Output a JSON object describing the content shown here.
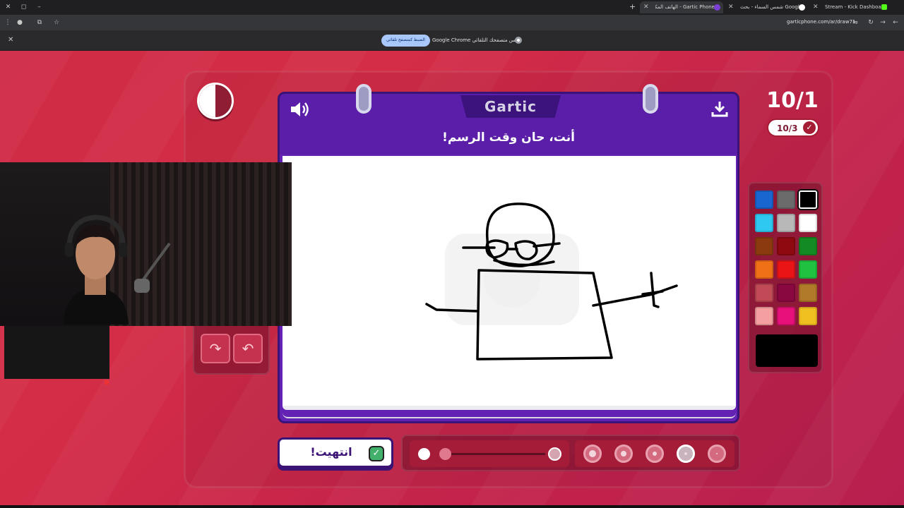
{
  "browser": {
    "tabs": [
      {
        "title": "Stream - Kick Dashboard",
        "active": false,
        "favicon_color": "#53fc18"
      },
      {
        "title": "شمس السماء - بحث Google",
        "active": false,
        "favicon_color": "#4285f4"
      },
      {
        "title": "Gartic Phone - الهاتف المكسور",
        "active": true,
        "favicon_color": "#7b3fd6"
      }
    ],
    "url": "garticphone.com/ar/draw71",
    "infobar_message": "Google Chrome ليس متصفحك التلقائي.",
    "infobar_button": "الضبط كمتصفح تلقائي"
  },
  "game": {
    "logo": "Gartic",
    "prompt": "أنت، حان وقت الرسم!",
    "round": "10/1",
    "done_count": "10/3",
    "done_button": "انتهيت!",
    "selected_color": "#000000",
    "palette": [
      "#1a66d0",
      "#6b6b6b",
      "#000000",
      "#2ec8f0",
      "#b8b8b8",
      "#ffffff",
      "#8b3a10",
      "#8f0a10",
      "#138a22",
      "#f07018",
      "#ea1416",
      "#20c040",
      "#c04a55",
      "#8a0840",
      "#b07a28",
      "#f5a0a0",
      "#e8107a",
      "#f0c020"
    ],
    "brush_sizes_selected_index": 3
  },
  "icons": {
    "speaker": "speaker-icon",
    "download": "download-icon",
    "undo": "undo-icon",
    "redo": "redo-icon",
    "timer": "timer-icon"
  }
}
